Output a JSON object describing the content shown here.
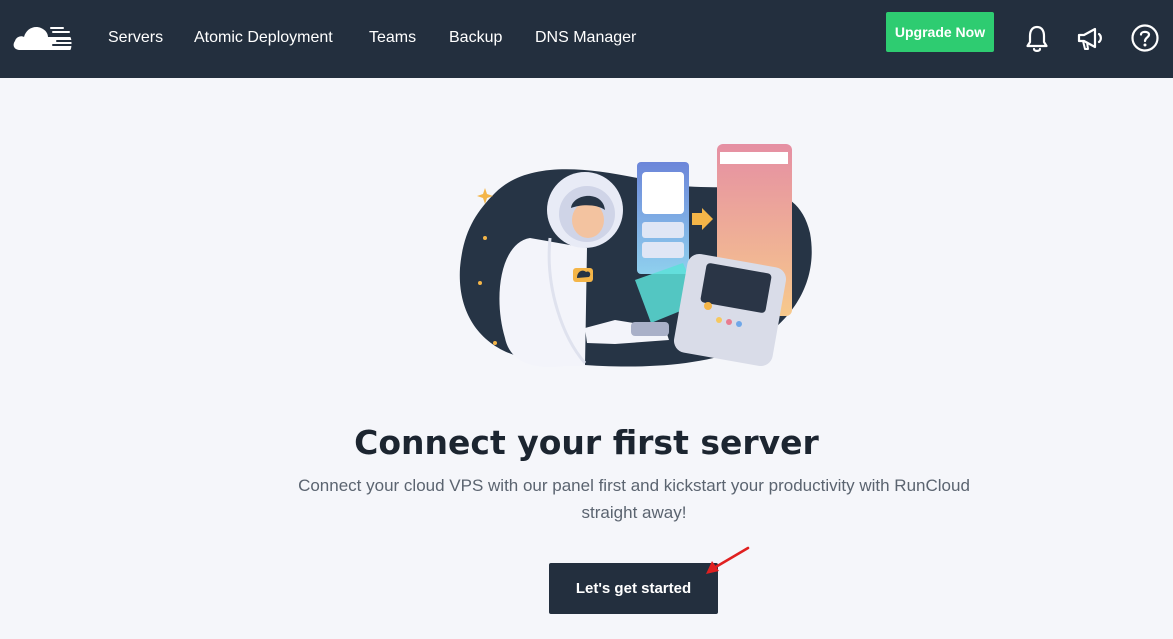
{
  "nav": {
    "logo_icon": "runcloud-cloud-logo",
    "links": [
      {
        "label": "Servers"
      },
      {
        "label": "Atomic Deployment"
      },
      {
        "label": "Teams"
      },
      {
        "label": "Backup"
      },
      {
        "label": "DNS Manager"
      }
    ],
    "upgrade_label": "Upgrade Now",
    "icons": [
      "bell-icon",
      "megaphone-icon",
      "help-icon"
    ]
  },
  "main": {
    "illustration_icon": "astronaut-server-illustration",
    "headline": "Connect your first server",
    "subtext": "Connect your cloud VPS with our panel first and kickstart your productivity with RunCloud straight away!",
    "cta_label": "Let's get started"
  },
  "colors": {
    "nav_bg": "#232f3e",
    "upgrade_green": "#2ecc71",
    "page_bg": "#f5f6fa",
    "cta_bg": "#232f3e",
    "annotation_red": "#e02020"
  }
}
